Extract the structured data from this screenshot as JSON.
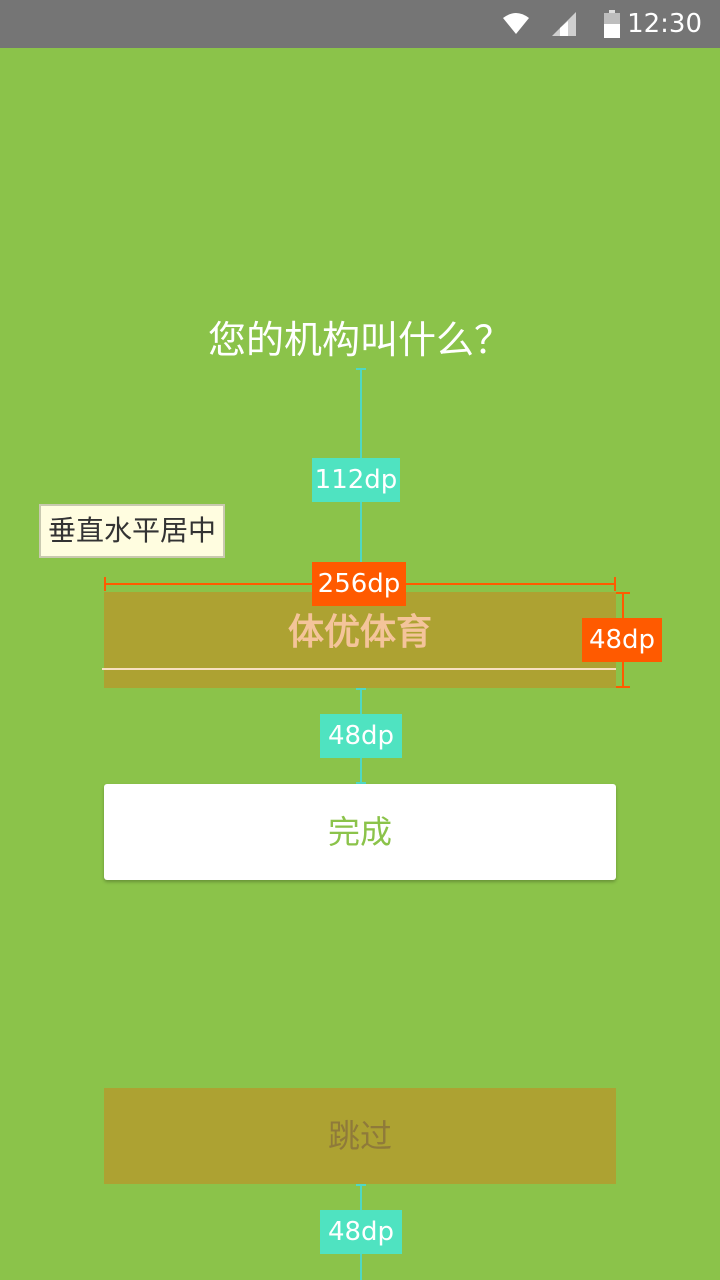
{
  "status_bar": {
    "time": "12:30"
  },
  "screen": {
    "title": "您的机构叫什么？",
    "input": {
      "value": "体优体育"
    },
    "done_button": "完成",
    "skip_button": "跳过"
  },
  "annotations": {
    "note": "垂直水平居中",
    "gap_title_input": "112dp",
    "input_width": "256dp",
    "input_height": "48dp",
    "gap_input_button": "48dp",
    "gap_bottom": "48dp"
  },
  "colors": {
    "background": "#8bc34a",
    "status_bar": "#757575",
    "guide_cyan": "#4fe3c1",
    "guide_orange": "#ff5a00",
    "highlight_box": "#ada232"
  }
}
